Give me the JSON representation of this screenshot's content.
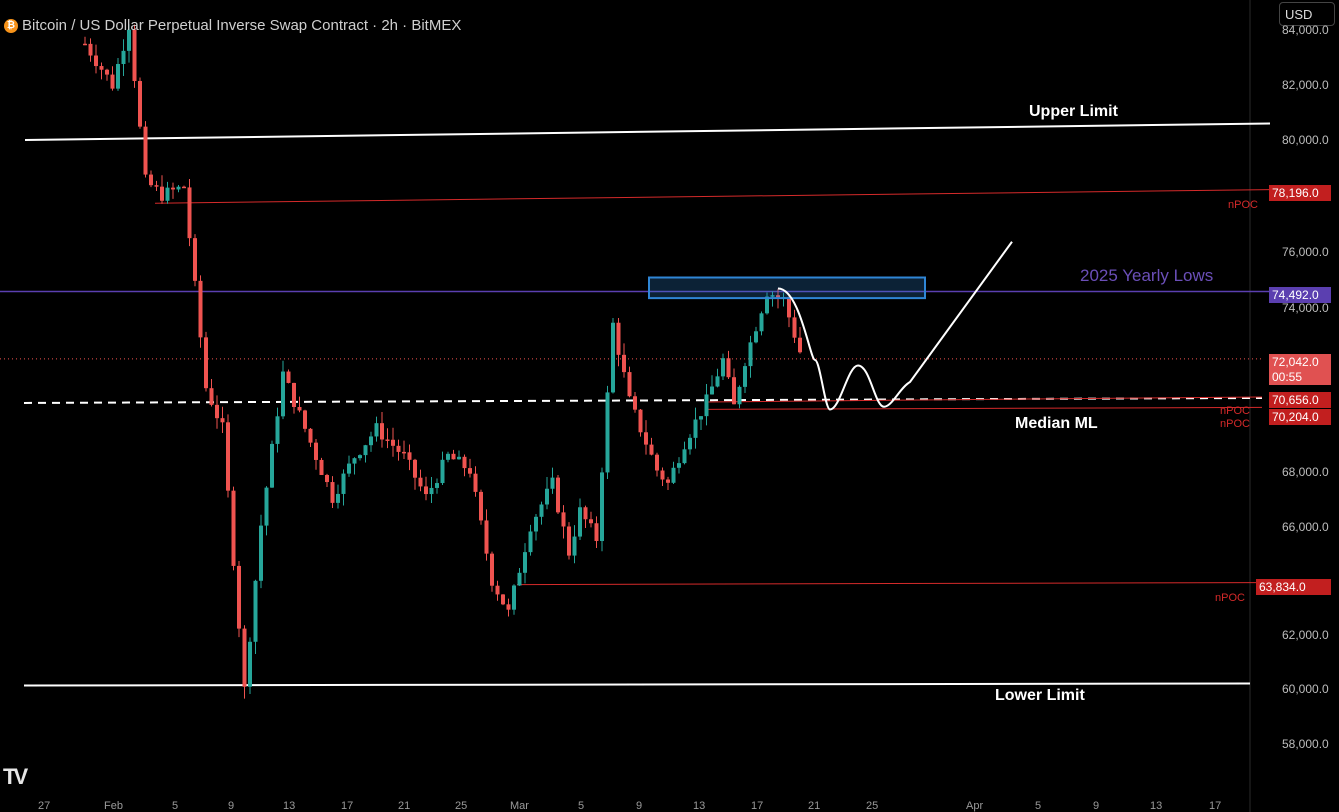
{
  "header": {
    "coin_symbol": "₿",
    "title": "Bitcoin / US Dollar Perpetual Inverse Swap Contract · 2h · BitMEX"
  },
  "currency": "USD",
  "logo": "TV",
  "colors": {
    "background": "#000000",
    "bull": "#26a69a",
    "bear": "#ef5350",
    "limit": "#ffffff",
    "npoc": "#d42a2a",
    "yearly_low": "#5b3fb0",
    "box": "#2f86d6"
  },
  "chart_data": {
    "type": "candlestick",
    "title": "Bitcoin / US Dollar Perpetual Inverse Swap Contract · 2h · BitMEX",
    "ylim": [
      56800,
      85000
    ],
    "y_ticks": [
      "84,000.0",
      "82,000.0",
      "80,000.0",
      "76,000.0",
      "74,000.0",
      "68,000.0",
      "66,000.0",
      "62,000.0",
      "60,000.0",
      "58,000.0"
    ],
    "x_ticks": [
      "27",
      "Feb",
      "5",
      "9",
      "13",
      "17",
      "21",
      "25",
      "Mar",
      "5",
      "9",
      "13",
      "17",
      "21",
      "25",
      "Apr",
      "5",
      "9",
      "13",
      "17"
    ],
    "price_path": [
      [
        0,
        83500
      ],
      [
        5,
        82000
      ],
      [
        8,
        84200
      ],
      [
        11,
        78500
      ],
      [
        14,
        78000
      ],
      [
        18,
        78300
      ],
      [
        22,
        71000
      ],
      [
        25,
        69500
      ],
      [
        29,
        60000
      ],
      [
        32,
        66000
      ],
      [
        36,
        71500
      ],
      [
        41,
        69000
      ],
      [
        45,
        67000
      ],
      [
        49,
        68500
      ],
      [
        53,
        69500
      ],
      [
        58,
        68500
      ],
      [
        62,
        67000
      ],
      [
        66,
        68500
      ],
      [
        70,
        68000
      ],
      [
        74,
        64000
      ],
      [
        77,
        62800
      ],
      [
        81,
        66000
      ],
      [
        85,
        67500
      ],
      [
        88,
        65000
      ],
      [
        90,
        66500
      ],
      [
        93,
        65500
      ],
      [
        96,
        73300
      ],
      [
        99,
        70500
      ],
      [
        101,
        69500
      ],
      [
        104,
        68000
      ],
      [
        106,
        67500
      ],
      [
        109,
        69000
      ],
      [
        113,
        70500
      ],
      [
        116,
        72000
      ],
      [
        118,
        70300
      ],
      [
        120,
        72000
      ],
      [
        124,
        74500
      ],
      [
        127,
        74200
      ],
      [
        130,
        72300
      ]
    ],
    "levels": [
      {
        "label": "Upper Limit",
        "start": 80000,
        "end": 80600
      },
      {
        "label": "nPOC",
        "start": 77700,
        "end": 78196
      },
      {
        "label": "2025 Yearly Lows",
        "value": 74492
      },
      {
        "label": "Median ML",
        "value": 70656
      },
      {
        "label": "nPOC",
        "value": 70656
      },
      {
        "label": "nPOC",
        "value": 70204
      },
      {
        "label": "nPOC",
        "value": 63834
      },
      {
        "label": "Lower Limit",
        "value": 60200
      }
    ],
    "resistance_box": {
      "low": 74250,
      "high": 75000
    },
    "projection": [
      74600,
      72000,
      70200,
      71800,
      70300,
      76300
    ],
    "last_price": {
      "value": "72,042.0",
      "countdown": "00:55"
    }
  },
  "annotations": {
    "upper_limit": "Upper Limit",
    "median_ml": "Median ML",
    "lower_limit": "Lower Limit",
    "yearly_lows": "2025 Yearly Lows",
    "npoc": "nPOC"
  },
  "price_tags": {
    "p78196": "78,196.0",
    "p74492": "74,492.0",
    "p72042": "72,042.0",
    "countdown": "00:55",
    "p70656": "70,656.0",
    "p70204": "70,204.0",
    "p63834": "63,834.0"
  }
}
